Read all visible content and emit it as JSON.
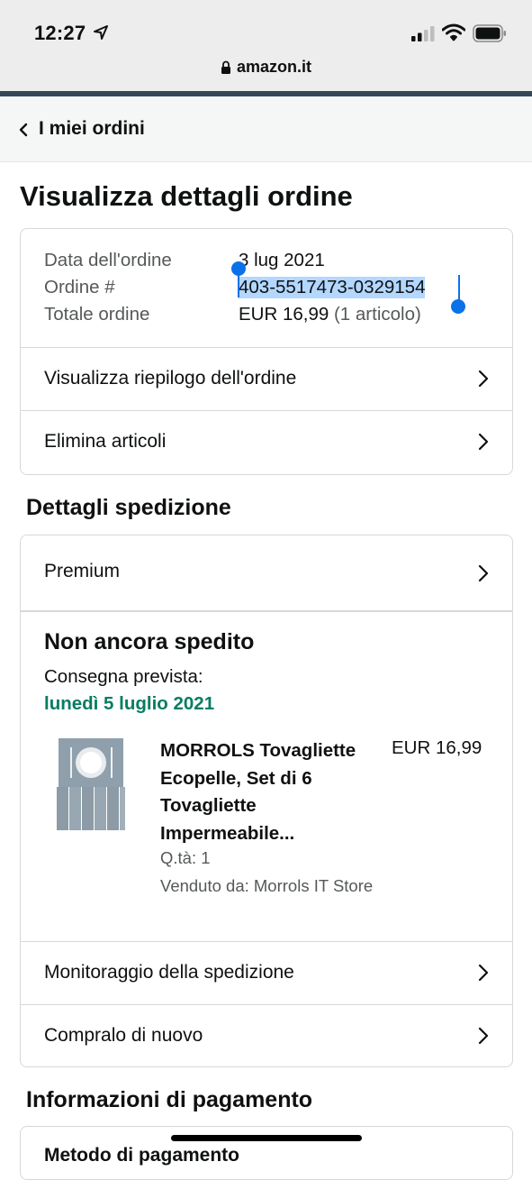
{
  "status_bar": {
    "time": "12:27"
  },
  "browser": {
    "url": "amazon.it"
  },
  "nav": {
    "back_label": "I miei ordini"
  },
  "page": {
    "title": "Visualizza dettagli ordine"
  },
  "order_summary": {
    "date_label": "Data dell'ordine",
    "date_value": "3 lug 2021",
    "number_label": "Ordine #",
    "number_value": "403-5517473-0329154",
    "total_label": "Totale ordine",
    "total_value": "EUR 16,99",
    "total_items": "(1 articolo)",
    "links": [
      {
        "label": "Visualizza riepilogo dell'ordine"
      },
      {
        "label": "Elimina articoli"
      }
    ]
  },
  "shipping": {
    "section_title": "Dettagli spedizione",
    "method": "Premium",
    "status": "Non ancora spedito",
    "delivery_label": "Consegna prevista:",
    "delivery_date": "lunedì 5 luglio 2021",
    "product": {
      "name": "MORROLS Tovagliette Ecopelle, Set di 6 Tovagliette Impermeabile...",
      "price": "EUR 16,99",
      "qty": "Q.tà: 1",
      "seller": "Venduto da: Morrols IT Store"
    },
    "links": [
      {
        "label": "Monitoraggio della spedizione"
      },
      {
        "label": "Compralo di nuovo"
      }
    ]
  },
  "payment": {
    "section_title": "Informazioni di pagamento",
    "first_row_partial": "Metodo di pagamento"
  },
  "colors": {
    "accent_green": "#067d62",
    "selection_blue": "#0a72e8",
    "nav_strip": "#37475a"
  }
}
